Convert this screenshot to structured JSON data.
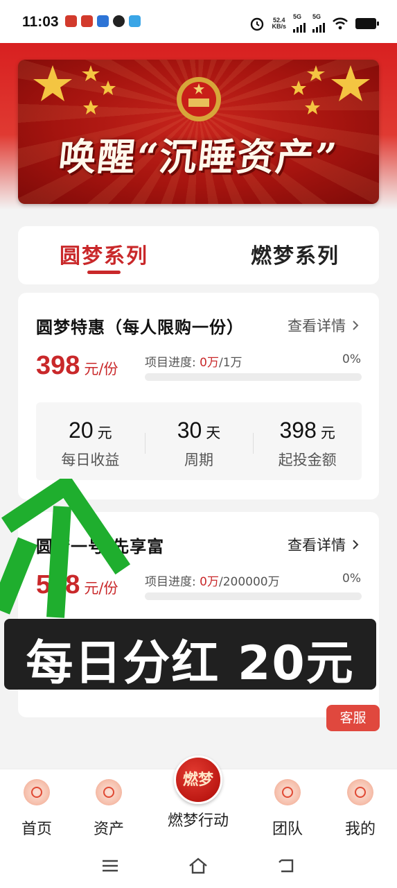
{
  "status_bar": {
    "time": "11:03",
    "net_speed_value": "52.4",
    "net_speed_unit": "KB/s",
    "signal1": "5G",
    "signal2": "5G"
  },
  "banner": {
    "title": "唤醒“沉睡资产”"
  },
  "tabs": [
    {
      "label": "圆梦系列"
    },
    {
      "label": "燃梦系列"
    }
  ],
  "products": [
    {
      "title": "圆梦特惠（每人限购一份）",
      "detail_link": "查看详情",
      "price": "398",
      "price_unit": "元/份",
      "progress_label": "项目进度:",
      "progress_done": "0万",
      "progress_total": "/1万",
      "progress_percent": "0%",
      "progress_fraction": 0,
      "stats": [
        {
          "value": "20",
          "unit": "元",
          "label": "每日收益"
        },
        {
          "value": "30",
          "unit": "天",
          "label": "周期"
        },
        {
          "value": "398",
          "unit": "元",
          "label": "起投金额"
        }
      ]
    },
    {
      "title": "圆梦一号·先享富",
      "detail_link": "查看详情",
      "price": "598",
      "price_unit": "元/份",
      "progress_label": "项目进度:",
      "progress_done": "0万",
      "progress_total": "/200000万",
      "progress_percent": "0%",
      "progress_fraction": 0
    }
  ],
  "overlay_caption": "每日分红 20元",
  "customer_service": "客服",
  "bottom_nav": [
    {
      "label": "首页"
    },
    {
      "label": "资产"
    },
    {
      "label": "燃梦行动",
      "icon_text": "燃梦"
    },
    {
      "label": "团队"
    },
    {
      "label": "我的"
    }
  ],
  "colors": {
    "accent": "#c9282a",
    "banner_red": "#a5140f",
    "arrow_green": "#1fae2e",
    "service_button": "#e0483e"
  }
}
